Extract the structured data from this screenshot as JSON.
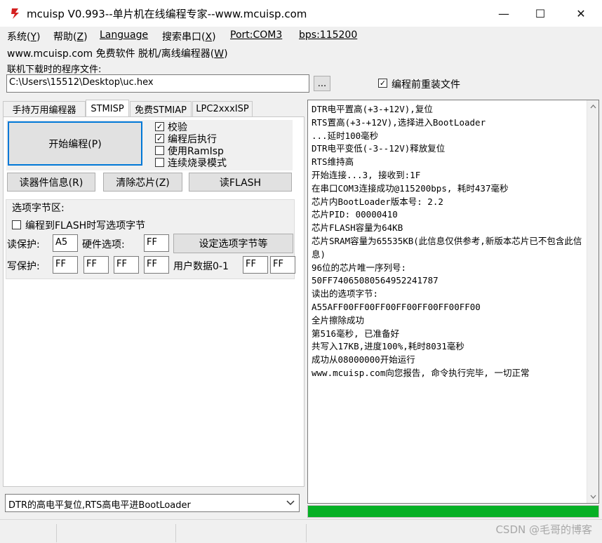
{
  "window": {
    "title": "mcuisp V0.993--单片机在线编程专家--www.mcuisp.com",
    "minimize": "—",
    "maximize": "☐",
    "close": "✕"
  },
  "menu": {
    "items": [
      {
        "text": "系统",
        "key": "Y"
      },
      {
        "text": "帮助",
        "key": "Z"
      },
      {
        "text": "Language",
        "key": ""
      },
      {
        "text": "搜索串口",
        "key": "X"
      },
      {
        "text": "Port:COM3",
        "key": ""
      },
      {
        "text": "bps:115200",
        "key": ""
      }
    ],
    "line2": "www.mcuisp.com 免费软件 脱机/离线编程器",
    "line2_key": "W"
  },
  "file": {
    "label": "联机下载时的程序文件:",
    "path": "C:\\Users\\15512\\Desktop\\uc.hex",
    "browse": "...",
    "reload_label": "编程前重装文件",
    "reload_checked": true
  },
  "tabs": [
    {
      "label": "手持万用编程器",
      "active": false
    },
    {
      "label": "STMISP",
      "active": true
    },
    {
      "label": "免费STMIAP",
      "active": false
    },
    {
      "label": "LPC2xxxISP",
      "active": false
    }
  ],
  "program": {
    "start_button": "开始编程(P)",
    "options": [
      {
        "label": "校验",
        "checked": true
      },
      {
        "label": "编程后执行",
        "checked": true
      },
      {
        "label": "使用RamIsp",
        "checked": false
      },
      {
        "label": "连续烧录模式",
        "checked": false
      }
    ],
    "read_info": "读器件信息(R)",
    "erase_chip": "清除芯片(Z)",
    "read_flash": "读FLASH"
  },
  "option_bytes": {
    "group_label": "选项字节区:",
    "write_label": "编程到FLASH时写选项字节",
    "read_protect_label": "读保护:",
    "read_protect_value": "A5",
    "hw_option_label": "硬件选项:",
    "hw_option_value": "FF",
    "set_button": "设定选项字节等",
    "write_protect_label": "写保护:",
    "write_protect_values": [
      "FF",
      "FF",
      "FF",
      "FF"
    ],
    "user_data_label": "用户数据0-1",
    "user_data_values": [
      "FF",
      "FF"
    ]
  },
  "reset_mode": "DTR的高电平复位,RTS高电平进BootLoader",
  "log": [
    "DTR电平置高(+3-+12V),复位",
    "RTS置高(+3-+12V),选择进入BootLoader",
    "...延时100毫秒",
    "DTR电平变低(-3--12V)释放复位",
    "RTS维持高",
    "开始连接...3, 接收到:1F",
    "在串口COM3连接成功@115200bps, 耗时437毫秒",
    "芯片内BootLoader版本号: 2.2",
    "芯片PID: 00000410",
    "芯片FLASH容量为64KB",
    "芯片SRAM容量为65535KB(此信息仅供参考,新版本芯片已不包含此信息)",
    "96位的芯片唯一序列号:",
    "50FF74065080564952241787",
    "读出的选项字节:",
    "A55AFF00FF00FF00FF00FF00FF00FF00",
    "全片擦除成功",
    "第516毫秒, 已准备好",
    "共写入17KB,进度100%,耗时8031毫秒",
    "成功从08000000开始运行",
    "www.mcuisp.com向您报告, 命令执行完毕, 一切正常"
  ],
  "progress": 1.0,
  "watermark": "CSDN @毛哥的博客",
  "colors": {
    "progress": "#06b025",
    "focus_border": "#0078d7"
  }
}
